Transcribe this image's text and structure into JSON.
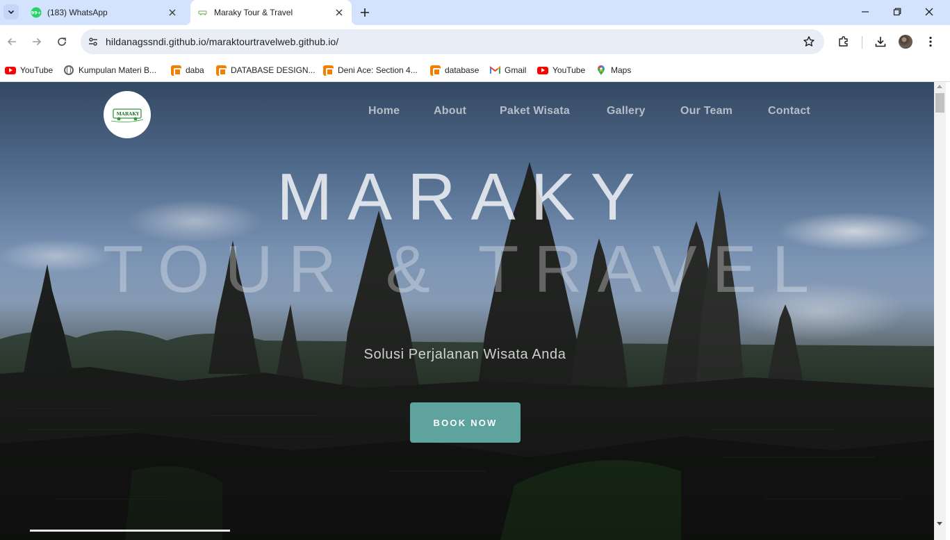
{
  "browser": {
    "tabs": [
      {
        "title": "(183) WhatsApp",
        "badge": "99+",
        "active": false
      },
      {
        "title": "Maraky Tour & Travel",
        "active": true
      }
    ],
    "url": "hildanagssndi.github.io/maraktourtravelweb.github.io/",
    "bookmarks": [
      {
        "label": "YouTube",
        "icon": "youtube-icon"
      },
      {
        "label": "Kumpulan Materi B...",
        "icon": "globe-icon"
      },
      {
        "label": "daba",
        "icon": "blogger-icon"
      },
      {
        "label": "DATABASE DESIGN...",
        "icon": "blogger-icon"
      },
      {
        "label": "Deni Ace: Section 4...",
        "icon": "blogger-icon"
      },
      {
        "label": "database",
        "icon": "blogger-icon"
      },
      {
        "label": "Gmail",
        "icon": "gmail-icon"
      },
      {
        "label": "YouTube",
        "icon": "youtube-icon"
      },
      {
        "label": "Maps",
        "icon": "maps-icon"
      }
    ]
  },
  "site": {
    "logo_text": "MARAKY",
    "nav": [
      "Home",
      "About",
      "Paket Wisata",
      "Gallery",
      "Our Team",
      "Contact"
    ],
    "hero_line1": "MARAKY",
    "hero_line2": "TOUR & TRAVEL",
    "tagline": "Solusi Perjalanan Wisata Anda",
    "cta": "BOOK NOW",
    "accent_color": "#5fa39e"
  }
}
